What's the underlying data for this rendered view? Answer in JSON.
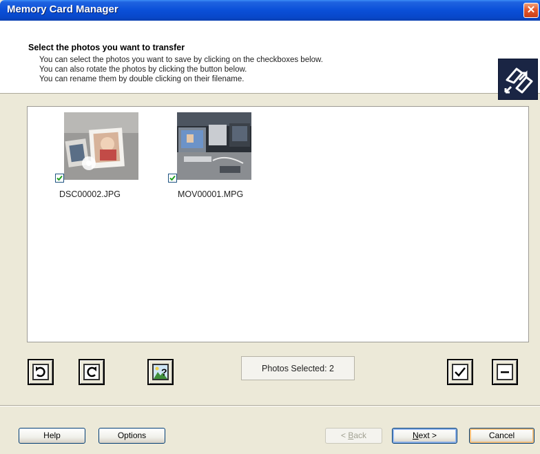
{
  "window": {
    "title": "Memory Card Manager",
    "close_glyph": "✕"
  },
  "header": {
    "heading": "Select the photos you want to transfer",
    "line1": "You can select the photos you want to save by clicking on the checkboxes below.",
    "line2": "You can also rotate the photos by clicking the button below.",
    "line3": "You can rename them by double clicking on their filename."
  },
  "photos": [
    {
      "filename": "DSC00002.JPG",
      "checked": true
    },
    {
      "filename": "MOV00001.MPG",
      "checked": true
    }
  ],
  "toolbar": {
    "rotate_left_icon": "rotate-left-icon",
    "rotate_right_icon": "rotate-right-icon",
    "photo_help_icon": "photo-help-icon",
    "select_all_icon": "check-all-icon",
    "deselect_all_icon": "uncheck-all-icon"
  },
  "status": {
    "photos_selected": "Photos Selected: 2"
  },
  "buttons": {
    "help": "Help",
    "options": "Options",
    "back_prefix": "< ",
    "back_key": "B",
    "back_rest": "ack",
    "next_key": "N",
    "next_rest": "ext >",
    "cancel": "Cancel"
  },
  "colors": {
    "title_bar": "#0a4fd8",
    "dialog_bg": "#ece9d8",
    "close_button": "#e3572c"
  }
}
